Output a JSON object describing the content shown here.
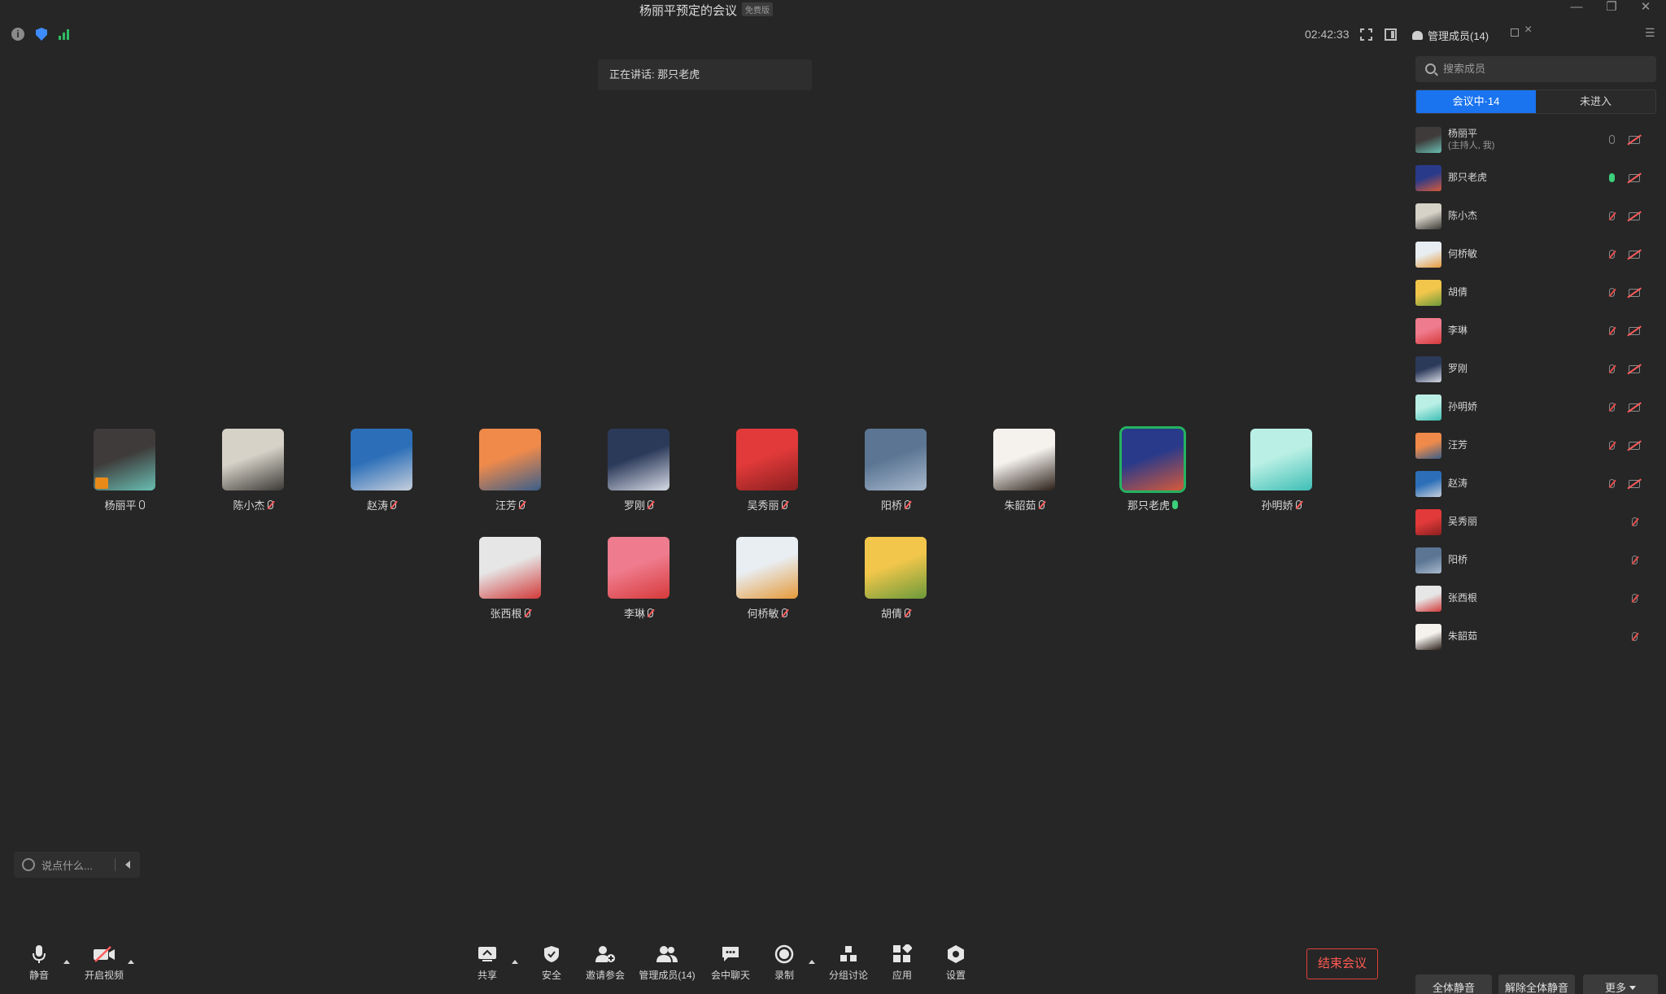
{
  "window": {
    "title": "杨丽平预定的会议",
    "edition_badge": "免费版",
    "min_glyph": "—",
    "restore_glyph": "❐",
    "close_glyph": "✕"
  },
  "status": {
    "timer": "02:42:33",
    "info_glyph": "i",
    "network_color": "#2fbd63",
    "security_color": "#3d8bff"
  },
  "speaking": {
    "text": "正在讲话: 那只老虎"
  },
  "gallery": [
    {
      "name": "杨丽平",
      "colors": [
        "#3e3b3a",
        "#69bfb3"
      ],
      "muted": false,
      "host": true
    },
    {
      "name": "陈小杰",
      "colors": [
        "#d6d2c8",
        "#3c3a36"
      ],
      "muted": true
    },
    {
      "name": "赵涛",
      "colors": [
        "#2c6fb8",
        "#c7cfdc"
      ],
      "muted": true
    },
    {
      "name": "汪芳",
      "colors": [
        "#ef8a4b",
        "#3a5f8a"
      ],
      "muted": true
    },
    {
      "name": "罗刚",
      "colors": [
        "#2c3a5a",
        "#d7dbe6"
      ],
      "muted": true
    },
    {
      "name": "吴秀丽",
      "colors": [
        "#e23a3a",
        "#8a1f1f"
      ],
      "muted": true
    },
    {
      "name": "阳桥",
      "colors": [
        "#5b7593",
        "#a8b9cd"
      ],
      "muted": true
    },
    {
      "name": "朱韶茹",
      "colors": [
        "#f5f2ee",
        "#2b2018"
      ],
      "muted": true
    },
    {
      "name": "那只老虎",
      "colors": [
        "#2a3a8a",
        "#d65a3a"
      ],
      "muted": false,
      "active": true
    },
    {
      "name": "孙明娇",
      "colors": [
        "#b9efe4",
        "#3fbfb6"
      ],
      "muted": true
    },
    {
      "name": "张西根",
      "colors": [
        "#e6e6e6",
        "#d23a3a"
      ],
      "muted": true
    },
    {
      "name": "李琳",
      "colors": [
        "#ef7c8e",
        "#d63a3a"
      ],
      "muted": true
    },
    {
      "name": "何桥敏",
      "colors": [
        "#e9eef3",
        "#e59a3a"
      ],
      "muted": true
    },
    {
      "name": "胡倩",
      "colors": [
        "#f1c64b",
        "#6b9a3a"
      ],
      "muted": true
    }
  ],
  "chat": {
    "placeholder": "说点什么..."
  },
  "toolbar": {
    "mute": "静音",
    "video": "开启视频",
    "share": "共享",
    "security": "安全",
    "invite": "邀请参会",
    "manage": "管理成员(14)",
    "chat": "会中聊天",
    "record": "录制",
    "breakout": "分组讨论",
    "apps": "应用",
    "settings": "设置",
    "end": "结束会议"
  },
  "panel": {
    "header": "管理成员(14)",
    "search_placeholder": "搜索成员",
    "tab_in": "会议中·14",
    "tab_out": "未进入",
    "members": [
      {
        "name": "杨丽平",
        "sub": "(主持人, 我)",
        "colors": [
          "#3e3b3a",
          "#69bfb3"
        ],
        "mic": "on",
        "cam": true
      },
      {
        "name": "那只老虎",
        "colors": [
          "#2a3a8a",
          "#d65a3a"
        ],
        "mic": "speaking",
        "cam": true
      },
      {
        "name": "陈小杰",
        "colors": [
          "#d6d2c8",
          "#3c3a36"
        ],
        "mic": "muted",
        "cam": true
      },
      {
        "name": "何桥敏",
        "colors": [
          "#e9eef3",
          "#e59a3a"
        ],
        "mic": "muted",
        "cam": true
      },
      {
        "name": "胡倩",
        "colors": [
          "#f1c64b",
          "#6b9a3a"
        ],
        "mic": "muted",
        "cam": true
      },
      {
        "name": "李琳",
        "colors": [
          "#ef7c8e",
          "#d63a3a"
        ],
        "mic": "muted",
        "cam": true
      },
      {
        "name": "罗刚",
        "colors": [
          "#2c3a5a",
          "#d7dbe6"
        ],
        "mic": "muted",
        "cam": true
      },
      {
        "name": "孙明娇",
        "colors": [
          "#b9efe4",
          "#3fbfb6"
        ],
        "mic": "muted",
        "cam": true
      },
      {
        "name": "汪芳",
        "colors": [
          "#ef8a4b",
          "#3a5f8a"
        ],
        "mic": "muted",
        "cam": true
      },
      {
        "name": "赵涛",
        "colors": [
          "#2c6fb8",
          "#c7cfdc"
        ],
        "mic": "muted",
        "cam": true
      },
      {
        "name": "吴秀丽",
        "colors": [
          "#e23a3a",
          "#8a1f1f"
        ],
        "mic": "muted",
        "cam": false
      },
      {
        "name": "阳桥",
        "colors": [
          "#5b7593",
          "#a8b9cd"
        ],
        "mic": "muted",
        "cam": false
      },
      {
        "name": "张西根",
        "colors": [
          "#e6e6e6",
          "#d23a3a"
        ],
        "mic": "muted",
        "cam": false
      },
      {
        "name": "朱韶茹",
        "colors": [
          "#f5f2ee",
          "#2b2018"
        ],
        "mic": "muted",
        "cam": false
      }
    ],
    "btn_mute_all": "全体静音",
    "btn_unmute_all": "解除全体静音",
    "btn_more": "更多"
  }
}
